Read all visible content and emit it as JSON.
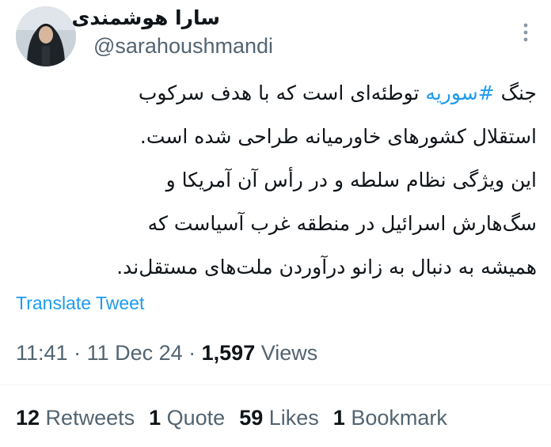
{
  "author": {
    "display_name": "سارا هوشمندی",
    "handle": "@sarahoushmandi"
  },
  "menu_icon": "more-vertical-icon",
  "tweet": {
    "lines": [
      {
        "before": "جنگ ",
        "hashtag": "#سوریه",
        "after": " توطئه‌ای است که با هدف سرکوب"
      },
      {
        "text": "استقلال کشورهای خاورمیانه طراحی شده است."
      },
      {
        "text": "این ویژگی نظام سلطه و در رأس آن آمریکا و"
      },
      {
        "text": "سگ‌هارش اسرائیل در منطقه غرب آسیاست که"
      },
      {
        "text": "همیشه به دنبال به زانو درآوردن ملت‌های مستقل‌ند."
      }
    ]
  },
  "translate_label": "Translate Tweet",
  "meta": {
    "time": "11:41",
    "sep1": " · ",
    "date": "11 Dec 24",
    "sep2": " · ",
    "views_count": "1,597",
    "views_label": " Views"
  },
  "stats": {
    "retweets": {
      "count": "12",
      "label": " Retweets"
    },
    "quotes": {
      "count": "1",
      "label": " Quote"
    },
    "likes": {
      "count": "59",
      "label": " Likes"
    },
    "bookmarks": {
      "count": "1",
      "label": " Bookmark"
    }
  },
  "colors": {
    "link": "#1d9bf0",
    "secondary_text": "#536471",
    "primary_text": "#0f1419"
  }
}
